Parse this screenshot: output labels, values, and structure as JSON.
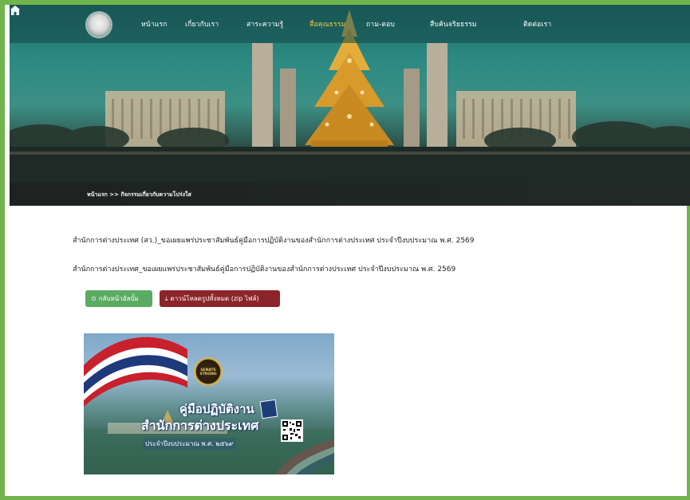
{
  "nav": {
    "items": [
      {
        "label": "หน้าแรก"
      },
      {
        "label": "เกี่ยวกับเรา"
      },
      {
        "label": "สาระความรู้"
      },
      {
        "label": "สื่อคุณธรรม"
      },
      {
        "label": "ถาม-ตอบ"
      },
      {
        "label": "สืบค้นจริยธรรม"
      },
      {
        "label": "ติดต่อเรา"
      }
    ],
    "active_index": 3
  },
  "breadcrumb": {
    "home": "หน้าแรก",
    "separator": ">>",
    "current": "กิจกรรมเกี่ยวกับความโปร่งใส"
  },
  "content": {
    "line1": "สำนักการต่างประเทศ (สว.)_ขอเผยแพร่ประชาสัมพันธ์คู่มือการปฏิบัติงานของสำนักการต่างประเทศ ประจำปีงบประมาณ พ.ศ. 2569",
    "line2": "สำนักการต่างประเทศ_ขอเผยแพร่ประชาสัมพันธ์คู่มือการปฏิบัติงานของสำนักการต่างประเทศ ประจำปีงบประมาณ พ.ศ. 2569",
    "back_button": "กลับหน้าอัลบั้ม",
    "download_button": "ดาวน์โหลดรูปทั้งหมด (zip ไฟล์)"
  },
  "poster": {
    "badge": "SENATE STRONG",
    "title1": "คู่มือปฏิบัติงาน",
    "title2": "สำนักการต่างประเทศ",
    "title3": "ประจำปีงบประมาณ พ.ศ. ๒๕๖๙"
  },
  "colors": {
    "frame": "#71b34c",
    "back_button": "#5cab62",
    "download_button": "#8b2529",
    "nav_active": "#f3c842"
  }
}
